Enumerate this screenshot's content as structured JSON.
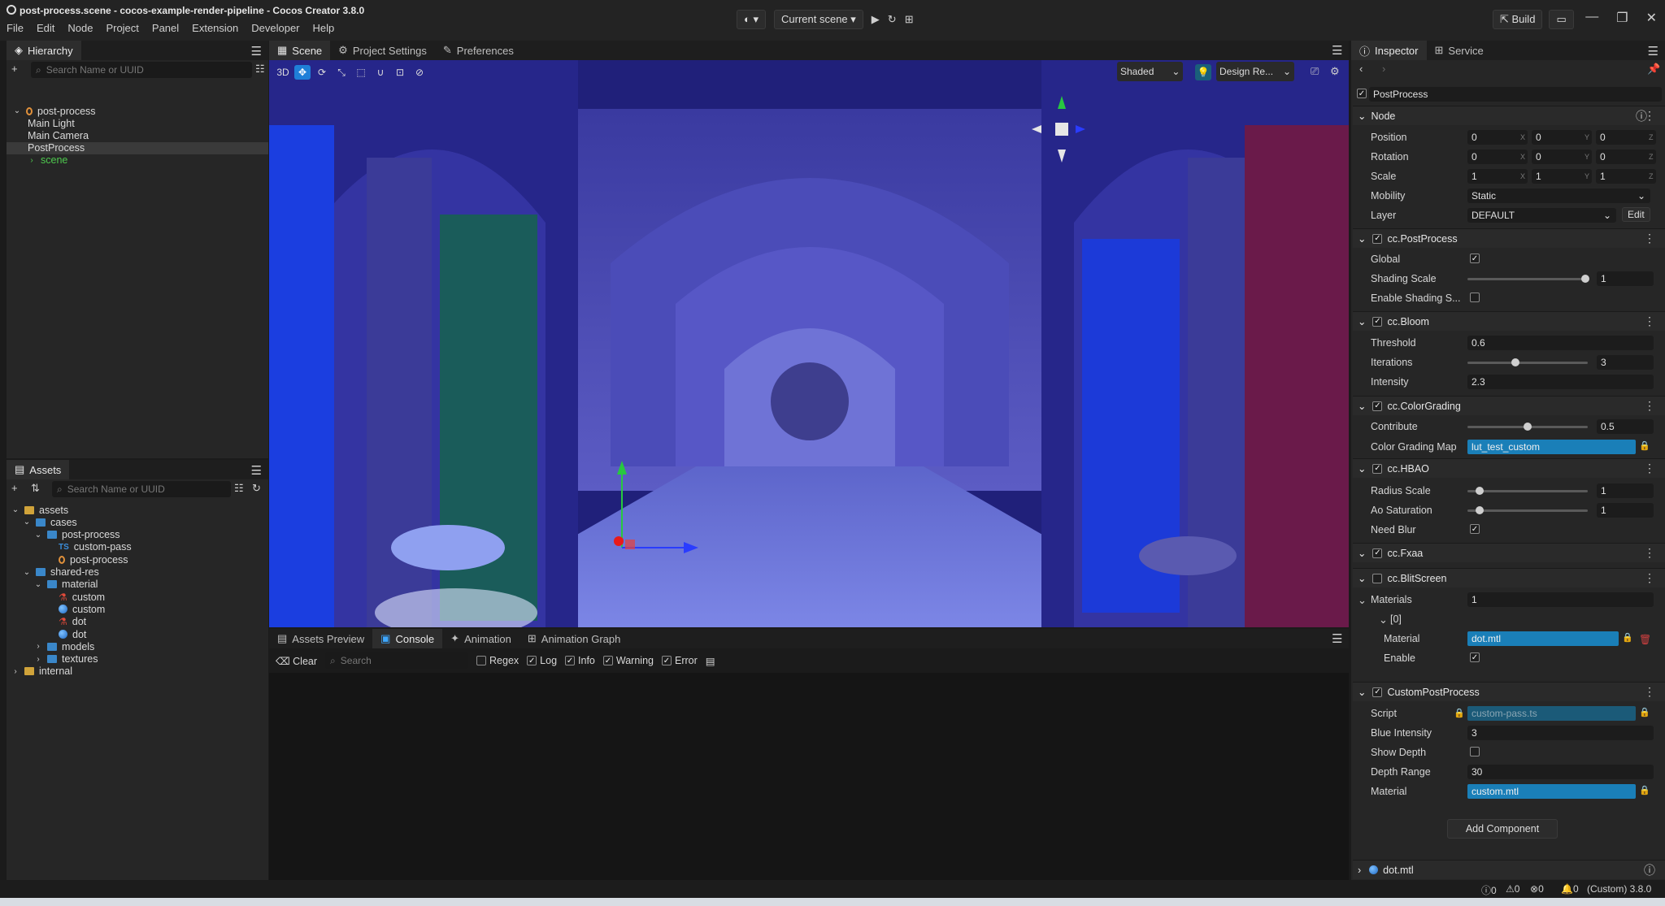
{
  "window": {
    "title": "post-process.scene - cocos-example-render-pipeline - Cocos Creator 3.8.0",
    "menu": [
      "File",
      "Edit",
      "Node",
      "Project",
      "Panel",
      "Extension",
      "Developer",
      "Help"
    ],
    "scene_select": "Current scene",
    "build_label": "Build"
  },
  "hierarchy": {
    "tab": "Hierarchy",
    "search_placeholder": "Search Name or UUID",
    "items": [
      {
        "label": "post-process",
        "depth": 0
      },
      {
        "label": "Main Light",
        "depth": 1
      },
      {
        "label": "Main Camera",
        "depth": 1
      },
      {
        "label": "PostProcess",
        "depth": 1,
        "selected": true
      },
      {
        "label": "scene",
        "depth": 1,
        "green": true
      }
    ]
  },
  "assets": {
    "tab": "Assets",
    "search_placeholder": "Search Name or UUID",
    "items": [
      {
        "label": "assets",
        "depth": 0,
        "icon": "folder-gold",
        "open": true
      },
      {
        "label": "cases",
        "depth": 1,
        "icon": "folder",
        "open": true
      },
      {
        "label": "post-process",
        "depth": 2,
        "icon": "folder",
        "open": true
      },
      {
        "label": "custom-pass",
        "depth": 3,
        "icon": "ts"
      },
      {
        "label": "post-process",
        "depth": 3,
        "icon": "scene"
      },
      {
        "label": "shared-res",
        "depth": 1,
        "icon": "folder",
        "open": true
      },
      {
        "label": "material",
        "depth": 2,
        "icon": "folder",
        "open": true
      },
      {
        "label": "custom",
        "depth": 3,
        "icon": "material"
      },
      {
        "label": "custom",
        "depth": 3,
        "icon": "sphere"
      },
      {
        "label": "dot",
        "depth": 3,
        "icon": "material"
      },
      {
        "label": "dot",
        "depth": 3,
        "icon": "sphere"
      },
      {
        "label": "models",
        "depth": 2,
        "icon": "folder",
        "closed": true
      },
      {
        "label": "textures",
        "depth": 2,
        "icon": "folder",
        "closed": true
      },
      {
        "label": "internal",
        "depth": 0,
        "icon": "folder-gold",
        "closed": true
      }
    ]
  },
  "scene_tabs": [
    "Scene",
    "Project Settings",
    "Preferences"
  ],
  "scene_toolbar": {
    "mode3d": "3D",
    "shading": "Shaded",
    "design_res": "Design Re..."
  },
  "bottom_tabs": [
    "Assets Preview",
    "Console",
    "Animation",
    "Animation Graph"
  ],
  "console": {
    "clear": "Clear",
    "search_placeholder": "Search",
    "filters": [
      {
        "label": "Regex",
        "checked": false
      },
      {
        "label": "Log",
        "checked": true
      },
      {
        "label": "Info",
        "checked": true
      },
      {
        "label": "Warning",
        "checked": true
      },
      {
        "label": "Error",
        "checked": true
      }
    ]
  },
  "inspector": {
    "tabs": [
      "Inspector",
      "Service"
    ],
    "node_name": "PostProcess",
    "node_section": "Node",
    "position": {
      "label": "Position",
      "x": "0",
      "y": "0",
      "z": "0"
    },
    "rotation": {
      "label": "Rotation",
      "x": "0",
      "y": "0",
      "z": "0"
    },
    "scale": {
      "label": "Scale",
      "x": "1",
      "y": "1",
      "z": "1"
    },
    "mobility": {
      "label": "Mobility",
      "value": "Static"
    },
    "layer": {
      "label": "Layer",
      "value": "DEFAULT",
      "edit": "Edit"
    },
    "postprocess": {
      "title": "cc.PostProcess",
      "global": "Global",
      "shading_scale": "Shading Scale",
      "shading_scale_value": "1",
      "shading_scale_fraction": 0.98,
      "enable_shading": "Enable Shading S..."
    },
    "bloom": {
      "title": "cc.Bloom",
      "threshold": "Threshold",
      "threshold_value": "0.6",
      "iterations": "Iterations",
      "iterations_value": "3",
      "iterations_fraction": 0.4,
      "intensity": "Intensity",
      "intensity_value": "2.3"
    },
    "colorgrading": {
      "title": "cc.ColorGrading",
      "contribute": "Contribute",
      "contribute_value": "0.5",
      "contribute_fraction": 0.5,
      "map_label": "Color Grading Map",
      "map_value": "lut_test_custom"
    },
    "hbao": {
      "title": "cc.HBAO",
      "radius": "Radius Scale",
      "radius_value": "1",
      "radius_fraction": 0.1,
      "ao": "Ao Saturation",
      "ao_value": "1",
      "ao_fraction": 0.1,
      "blur": "Need Blur"
    },
    "fxaa": {
      "title": "cc.Fxaa"
    },
    "blit": {
      "title": "cc.BlitScreen",
      "materials": "Materials",
      "materials_value": "1",
      "index": "[0]",
      "material": "Material",
      "material_value": "dot.mtl",
      "enable": "Enable"
    },
    "custom": {
      "title": "CustomPostProcess",
      "script": "Script",
      "script_value": "custom-pass.ts",
      "blue": "Blue Intensity",
      "blue_value": "3",
      "depth": "Show Depth",
      "range": "Depth Range",
      "range_value": "30",
      "material": "Material",
      "material_value": "custom.mtl"
    },
    "add_component": "Add Component",
    "footer_asset": "dot.mtl"
  },
  "statusbar": {
    "c1": "0",
    "c2": "0",
    "c3": "0",
    "c4": "0",
    "version": "(Custom) 3.8.0"
  }
}
